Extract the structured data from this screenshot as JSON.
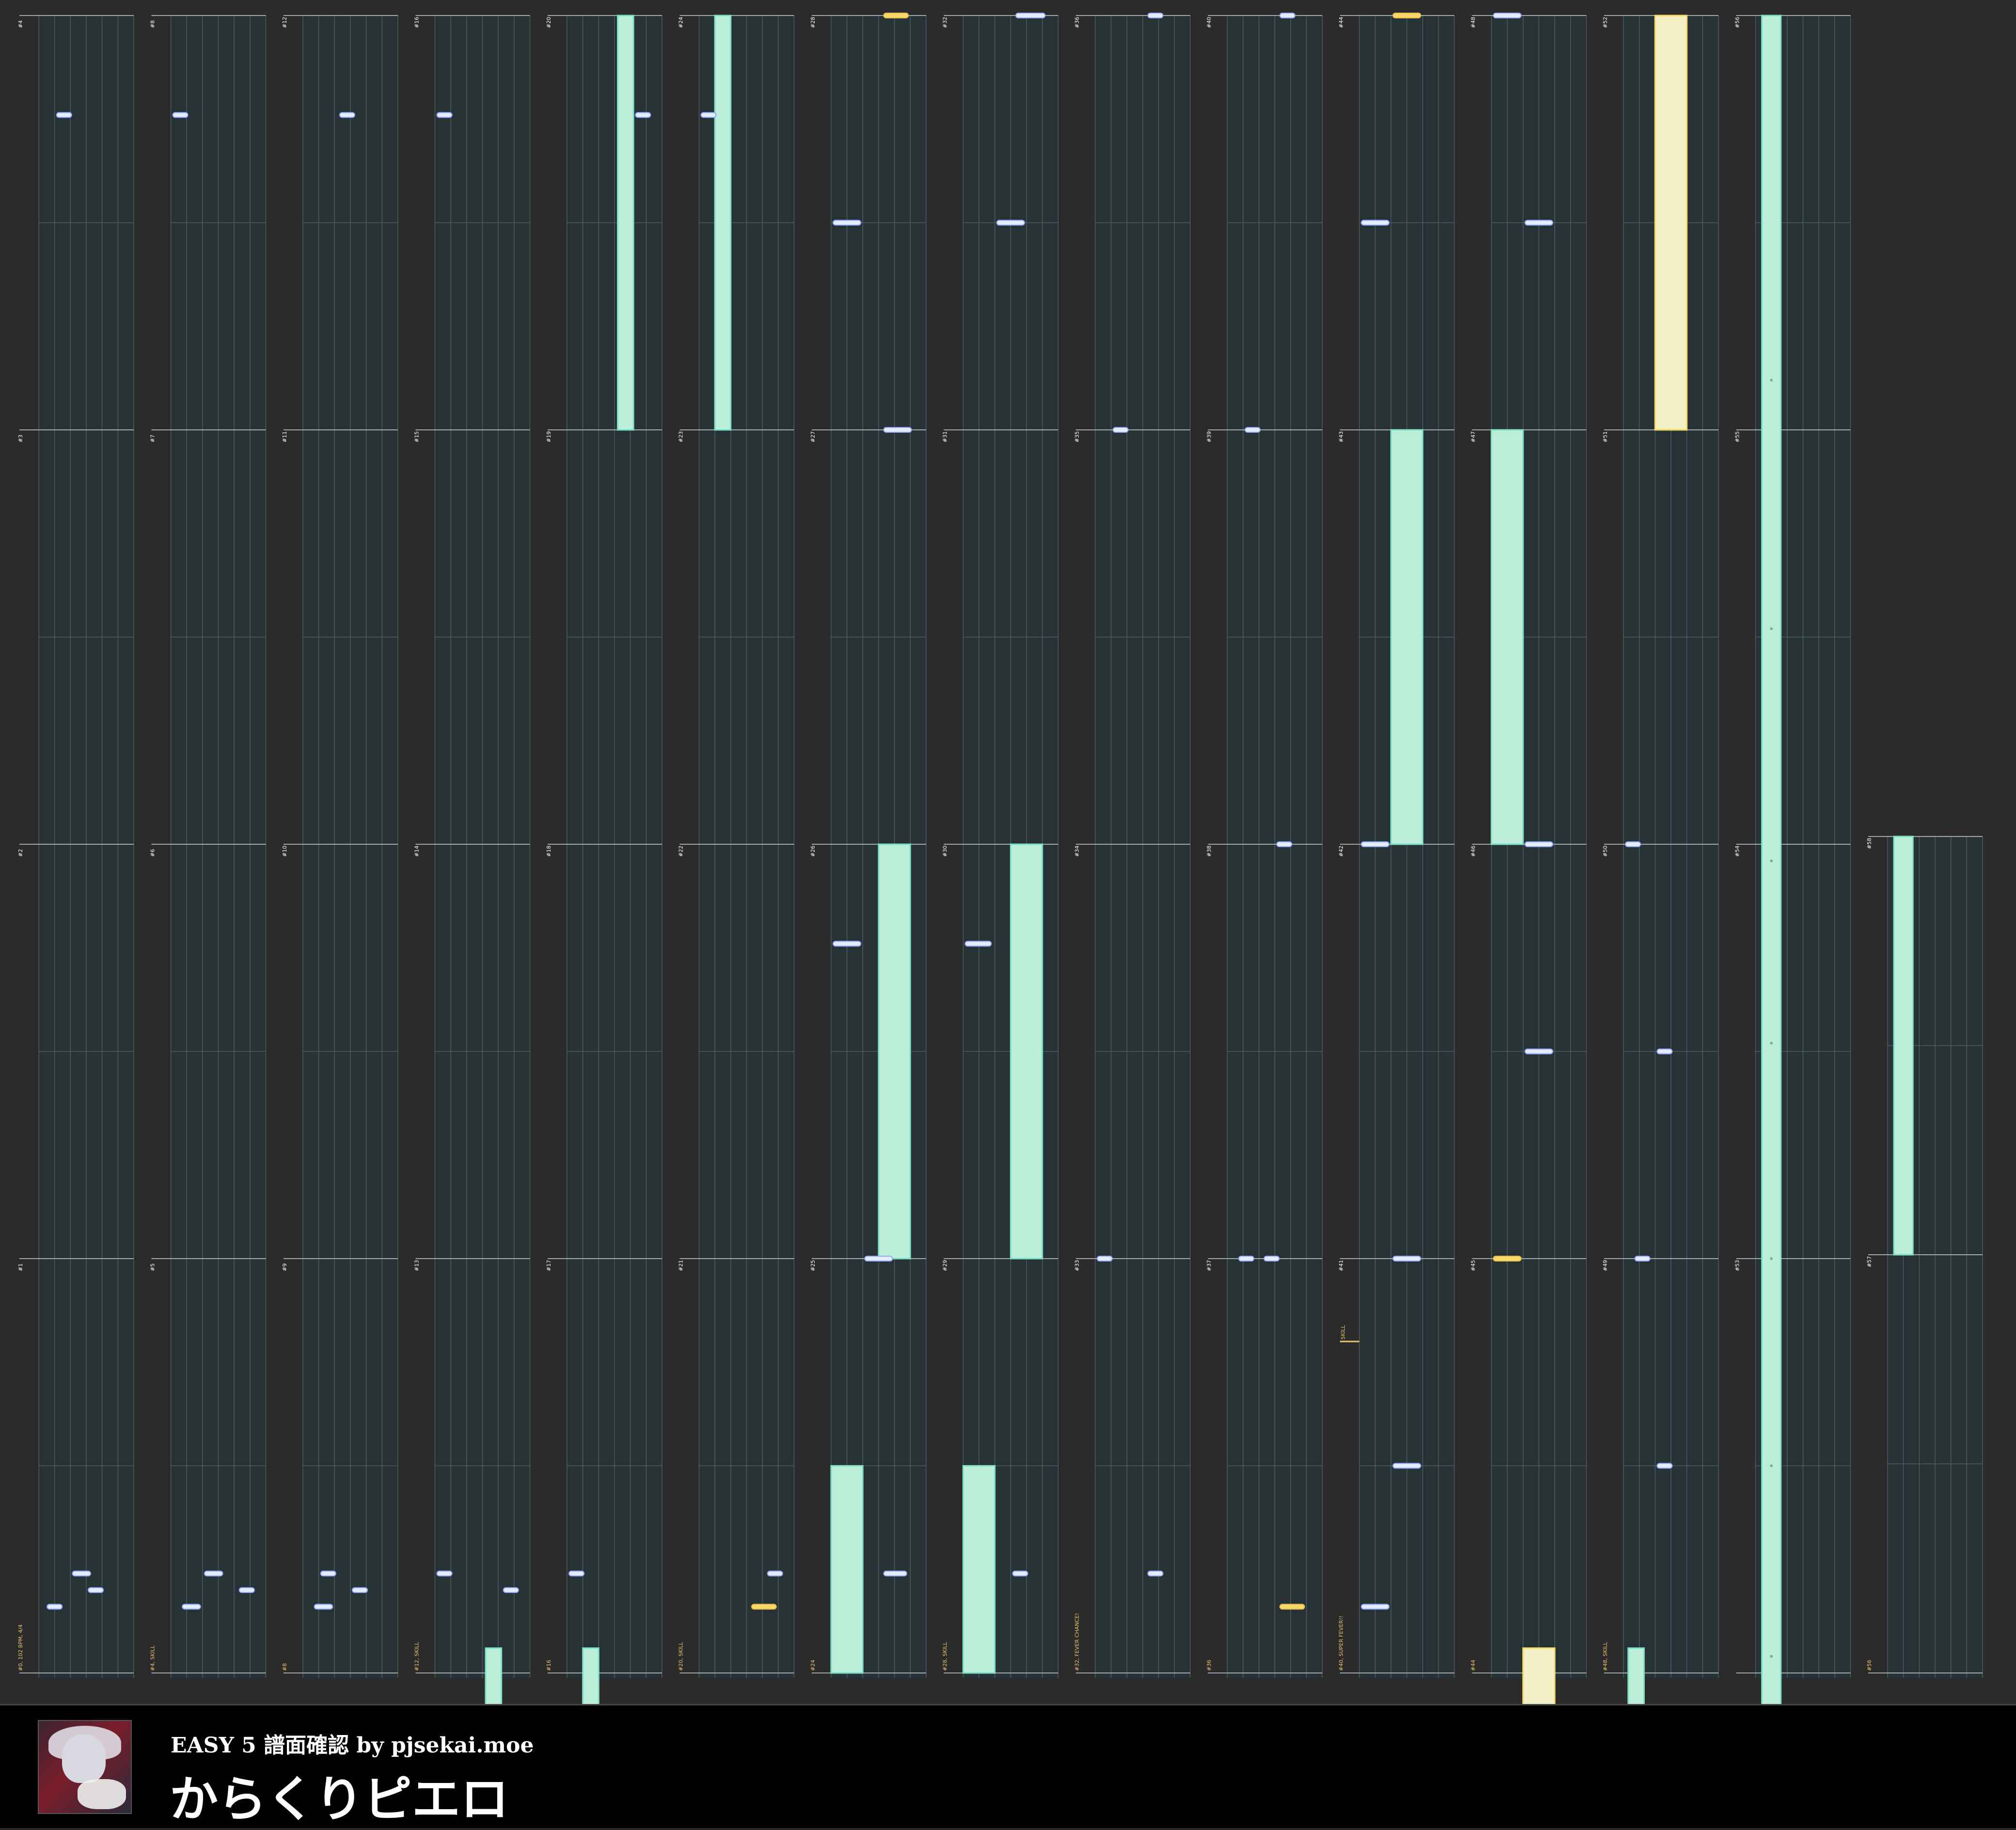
{
  "page": {
    "background": "#2b2b2b"
  },
  "header": {
    "subtitle": "EASY 5 譜面確認 by pjsekai.moe",
    "title": "からくりピエロ"
  },
  "jacket": {
    "icon": "song-jacket-image"
  },
  "colors": {
    "lane_bg": "#263234",
    "grid": "#5c6d70",
    "tap": "#e6ecff",
    "slide": "#bdeed9",
    "slide_edge": "#7be0c5",
    "critical": "#f5d96a",
    "critical_slide": "#f3f0c6",
    "marker": "#e8c470"
  },
  "columns": [
    {
      "measures": [
        "#1",
        "#2",
        "#3",
        "#4"
      ],
      "bottom_label": "#0, 102 BPM, 4/4",
      "taps": [
        [
          0.95,
          3,
          4.2
        ],
        [
          0.06,
          1,
          2.2
        ],
        [
          0.94,
          2,
          3.4
        ],
        [
          0.96,
          0.4,
          1.6
        ]
      ],
      "slides": [],
      "crit": []
    },
    {
      "measures": [
        "#5",
        "#6",
        "#7",
        "#8"
      ],
      "bottom_label": "#4, SKILL",
      "taps": [
        [
          0.95,
          4.2,
          5.4
        ],
        [
          0.06,
          0,
          1.2
        ],
        [
          0.94,
          2,
          3.4
        ],
        [
          0.96,
          0.6,
          2
        ]
      ],
      "slides": [],
      "crit": []
    },
    {
      "measures": [
        "#9",
        "#10",
        "#11",
        "#12"
      ],
      "bottom_label": "#8",
      "taps": [
        [
          0.95,
          3,
          4.2
        ],
        [
          0.06,
          2.2,
          3.4
        ],
        [
          0.94,
          1,
          2.2
        ],
        [
          0.96,
          0.6,
          2
        ]
      ],
      "slides": [],
      "crit": []
    },
    {
      "measures": [
        "#13",
        "#14",
        "#15",
        "#16"
      ],
      "bottom_label": "#12, SKILL",
      "taps": [
        [
          0.95,
          4.2,
          5.4
        ],
        [
          0.06,
          0,
          1.2
        ],
        [
          0.94,
          0,
          1.2
        ]
      ],
      "slides": [
        [
          0.985,
          1.03,
          3.2,
          4.2
        ]
      ],
      "crit": []
    },
    {
      "measures": [
        "#17",
        "#18",
        "#19",
        "#20"
      ],
      "bottom_label": "#16",
      "taps": [
        [
          0.94,
          0,
          1.2
        ],
        [
          0.06,
          4.2,
          5.4
        ]
      ],
      "slides": [
        [
          0,
          0.25,
          3.2,
          4.2
        ],
        [
          0.985,
          1.03,
          1,
          2
        ]
      ],
      "crit": []
    },
    {
      "measures": [
        "#21",
        "#22",
        "#23",
        "#24"
      ],
      "bottom_label": "#20, SKILL",
      "taps": [
        [
          0.94,
          4.2,
          5.4
        ],
        [
          0.06,
          0,
          1.2
        ]
      ],
      "slides": [
        [
          0,
          0.25,
          1,
          2
        ]
      ],
      "crit": [
        [
          0.96,
          3.2,
          5
        ]
      ]
    },
    {
      "measures": [
        "#25",
        "#26",
        "#27",
        "#28"
      ],
      "bottom_label": "#24",
      "taps": [
        [
          0.125,
          0,
          2
        ],
        [
          0.25,
          3.2,
          5.2
        ],
        [
          0.56,
          0,
          2
        ],
        [
          0.94,
          3.2,
          4.9
        ],
        [
          0.75,
          2,
          4
        ]
      ],
      "slides": [
        [
          0.5,
          0.75,
          3,
          5
        ],
        [
          0.875,
          1,
          0,
          2
        ]
      ],
      "crit": [
        [
          0,
          3.2,
          5
        ]
      ]
    },
    {
      "measures": [
        "#29",
        "#30",
        "#31",
        "#32"
      ],
      "bottom_label": "#28, SKILL",
      "taps": [
        [
          0,
          3.2,
          5.3
        ],
        [
          0.125,
          2,
          4
        ],
        [
          0.56,
          0,
          1.9
        ],
        [
          0.94,
          3,
          4.2
        ]
      ],
      "slides": [
        [
          0.5,
          0.75,
          3,
          5
        ],
        [
          0.875,
          1,
          0,
          2
        ]
      ],
      "crit": []
    },
    {
      "measures": [
        "#33",
        "#34",
        "#35",
        "#36"
      ],
      "bottom_label": "#32, FEVER CHANCE!",
      "taps": [
        [
          0,
          3.2,
          4.4
        ],
        [
          0.25,
          1,
          2.2
        ],
        [
          0.75,
          0,
          1.2
        ],
        [
          0.94,
          3.2,
          4.4
        ]
      ],
      "slides": [],
      "crit": []
    },
    {
      "measures": [
        "#37",
        "#38",
        "#39",
        "#40"
      ],
      "bottom_label": "#36",
      "taps": [
        [
          0,
          3.2,
          4.4
        ],
        [
          0.25,
          1,
          2.2
        ],
        [
          0.5,
          3,
          4.2
        ],
        [
          0.75,
          0.6,
          1.8
        ],
        [
          0.75,
          2.2,
          3.4
        ]
      ],
      "slides": [],
      "crit": [
        [
          0.96,
          3.2,
          5
        ]
      ]
    },
    {
      "measures": [
        "#41",
        "#42",
        "#43",
        "#44"
      ],
      "bottom_label": "#40, SUPER FEVER!!",
      "taps": [
        [
          0.125,
          0,
          2
        ],
        [
          0.5,
          0,
          2
        ],
        [
          0.75,
          2,
          4
        ],
        [
          0.875,
          2,
          4
        ],
        [
          0.96,
          0,
          2
        ]
      ],
      "slides": [
        [
          0.25,
          0.5,
          2,
          4
        ]
      ],
      "crit": [
        [
          0,
          2,
          4
        ]
      ],
      "side_marker": "SKILL"
    },
    {
      "measures": [
        "#45",
        "#46",
        "#47",
        "#48"
      ],
      "bottom_label": "#44",
      "taps": [
        [
          0,
          0,
          2
        ],
        [
          0.125,
          2,
          4
        ],
        [
          0.5,
          2,
          4
        ],
        [
          0.625,
          2,
          4
        ]
      ],
      "slides": [
        [
          0.25,
          0.5,
          0,
          2
        ]
      ],
      "crit": [
        [
          0.75,
          0,
          2
        ]
      ],
      "crit_slides": [
        [
          0.985,
          1.03,
          2,
          4
        ]
      ]
    },
    {
      "measures": [
        "#49",
        "#50",
        "#51",
        "#52"
      ],
      "bottom_label": "#48, SKILL",
      "taps": [
        [
          0.5,
          0,
          1.2
        ],
        [
          0.625,
          2,
          3.2
        ],
        [
          0.75,
          0.6,
          1.8
        ],
        [
          0.875,
          2,
          3.2
        ]
      ],
      "slides": [
        [
          0.985,
          1.03,
          0.3,
          1.3
        ]
      ],
      "crit": [],
      "crit_slides": [
        [
          0,
          0.25,
          2,
          4
        ]
      ]
    },
    {
      "measures": [
        "#53",
        "#54",
        "#55",
        "#56"
      ],
      "bottom_label": "",
      "taps": [],
      "slides": [
        [
          0,
          1.03,
          0.4,
          1.6
        ]
      ],
      "crit": [],
      "tick_dots": [
        0.22,
        0.37,
        0.51,
        0.62,
        0.75,
        0.875,
        0.99
      ]
    },
    {
      "measures": [
        "#57",
        "#58"
      ],
      "bottom_label": "#56",
      "taps": [],
      "slides": [
        [
          0,
          0.5,
          0.4,
          1.6
        ]
      ],
      "crit": []
    }
  ]
}
